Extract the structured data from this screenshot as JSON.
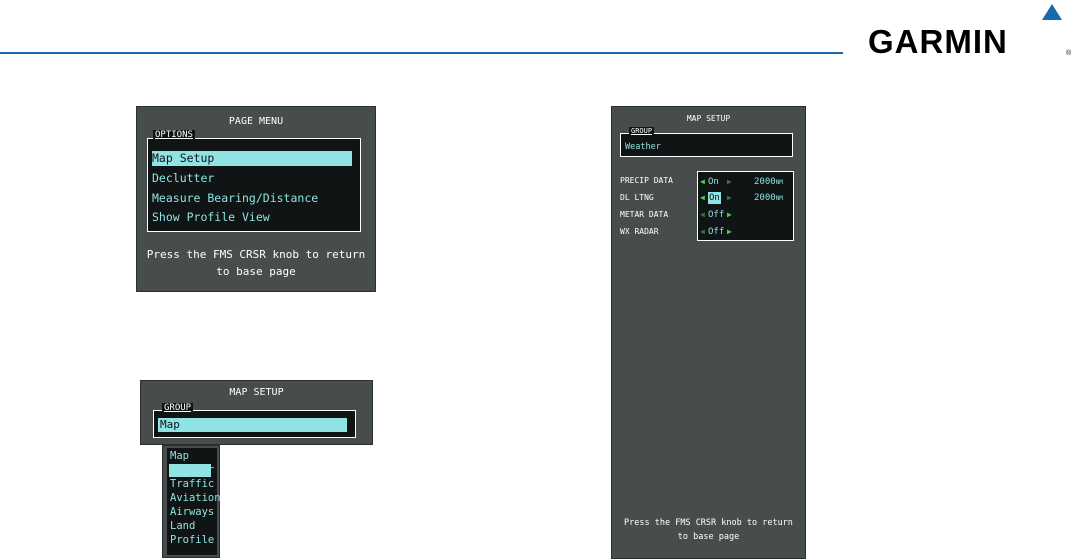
{
  "header": {
    "brand": "GARMIN",
    "reg": "®"
  },
  "page_menu": {
    "title": "PAGE MENU",
    "legend": "OPTIONS",
    "items": [
      "Map Setup",
      "Declutter",
      "Measure Bearing/Distance",
      "Show Profile View"
    ],
    "selected_index": 0,
    "hint_line1": "Press the FMS CRSR knob to return",
    "hint_line2": "to base page"
  },
  "map_setup_group": {
    "title": "MAP SETUP",
    "legend": "GROUP",
    "selected_value": "Map"
  },
  "group_dropdown": {
    "options": [
      "Map",
      "Weather",
      "Traffic",
      "Aviation",
      "Airways",
      "Land",
      "Profile"
    ],
    "highlighted_index": 1
  },
  "map_setup_weather": {
    "title": "MAP SETUP",
    "legend": "GROUP",
    "group_value": "Weather",
    "rows": [
      {
        "label": "PRECIP DATA",
        "state": "On",
        "range": "2000",
        "unit": "NM"
      },
      {
        "label": "DL LTNG",
        "state": "On",
        "range": "2000",
        "unit": "NM"
      },
      {
        "label": "METAR DATA",
        "state": "Off"
      },
      {
        "label": "WX RADAR",
        "state": "Off"
      }
    ],
    "hint_line1": "Press the FMS CRSR knob to return",
    "hint_line2": "to base page"
  },
  "colors": {
    "accent_blue": "#1a69b0",
    "panel": "#474d4c",
    "cyan": "#8fe3e3",
    "green": "#46d34a"
  }
}
